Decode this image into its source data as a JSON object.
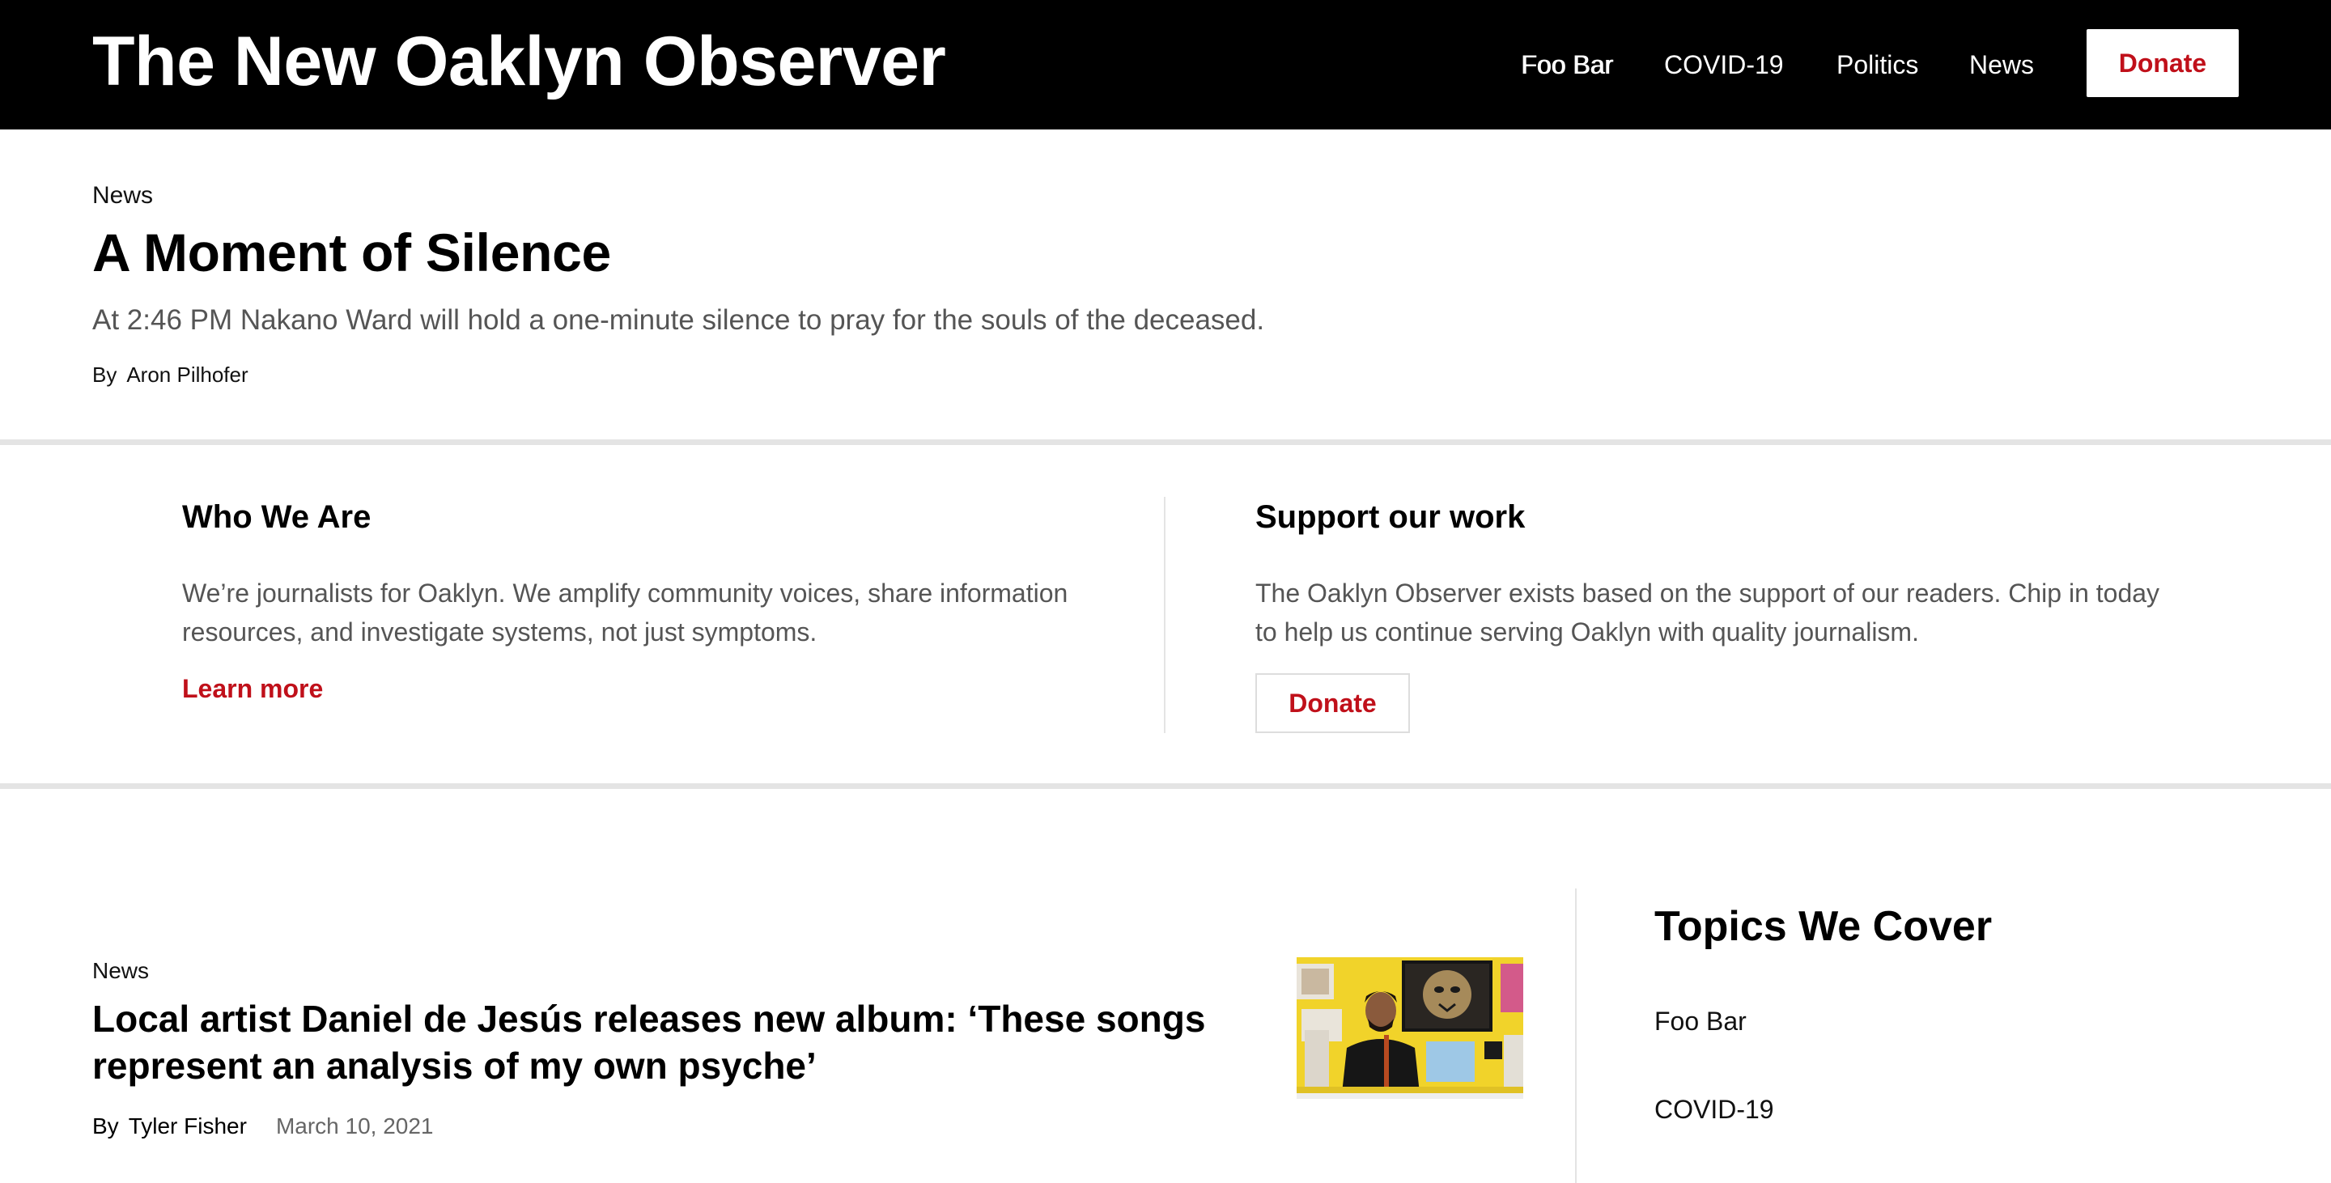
{
  "header": {
    "site_title": "The New Oaklyn Observer",
    "nav": [
      "Foo Bar",
      "COVID-19",
      "Politics",
      "News"
    ],
    "donate_label": "Donate"
  },
  "feature": {
    "category": "News",
    "title": "A Moment of Silence",
    "dek": "At 2:46 PM Nakano Ward will hold a one-minute silence to pray for the souls of the deceased.",
    "byline_prefix": "By",
    "author": "Aron Pilhofer"
  },
  "about": {
    "heading": "Who We Are",
    "text": "We’re journalists for Oaklyn. We amplify community voices, share information resources, and investigate systems, not just symptoms.",
    "link_label": "Learn more"
  },
  "support": {
    "heading": "Support our work",
    "text": "The Oaklyn Observer exists based on the support of our readers. Chip in today to help us continue serving Oaklyn with quality journalism.",
    "button_label": "Donate"
  },
  "story": {
    "category": "News",
    "title": "Local artist Daniel de Jesús releases new album: ‘These songs represent an analysis of my own psyche’",
    "byline_prefix": "By",
    "author": "Tyler Fisher",
    "date": "March 10, 2021"
  },
  "topics": {
    "heading": "Topics We Cover",
    "items": [
      "Foo Bar",
      "COVID-19"
    ]
  },
  "colors": {
    "header_bg": "#000000",
    "accent_red": "#c0101a",
    "divider_gray": "#e4e4e4"
  }
}
